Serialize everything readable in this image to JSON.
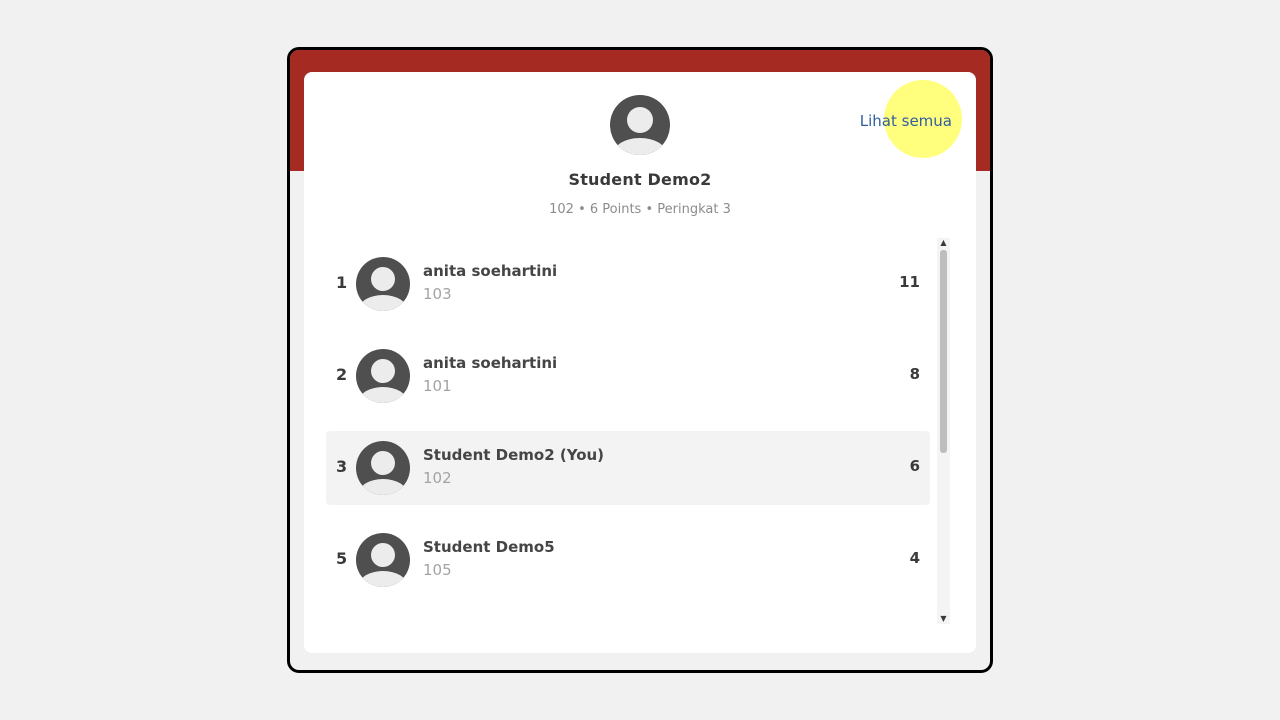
{
  "colors": {
    "header_band": "#a42a22",
    "link": "#2f5f9e",
    "highlight": "#ffff60"
  },
  "current_user": {
    "avatar_icon": "user-avatar-icon",
    "name": "Student Demo2",
    "summary": "102 • 6 Points • Peringkat 3"
  },
  "see_all_label": "Lihat semua",
  "leaderboard": [
    {
      "rank": "1",
      "name": "anita soehartini",
      "id": "103",
      "score": "11",
      "current": false
    },
    {
      "rank": "2",
      "name": "anita soehartini",
      "id": "101",
      "score": "8",
      "current": false
    },
    {
      "rank": "3",
      "name": "Student Demo2 (You)",
      "id": "102",
      "score": "6",
      "current": true
    },
    {
      "rank": "5",
      "name": "Student Demo5",
      "id": "105",
      "score": "4",
      "current": false
    }
  ],
  "scrollbar": {
    "up_arrow": "▲",
    "down_arrow": "▼",
    "thumb_fraction": 0.56
  }
}
